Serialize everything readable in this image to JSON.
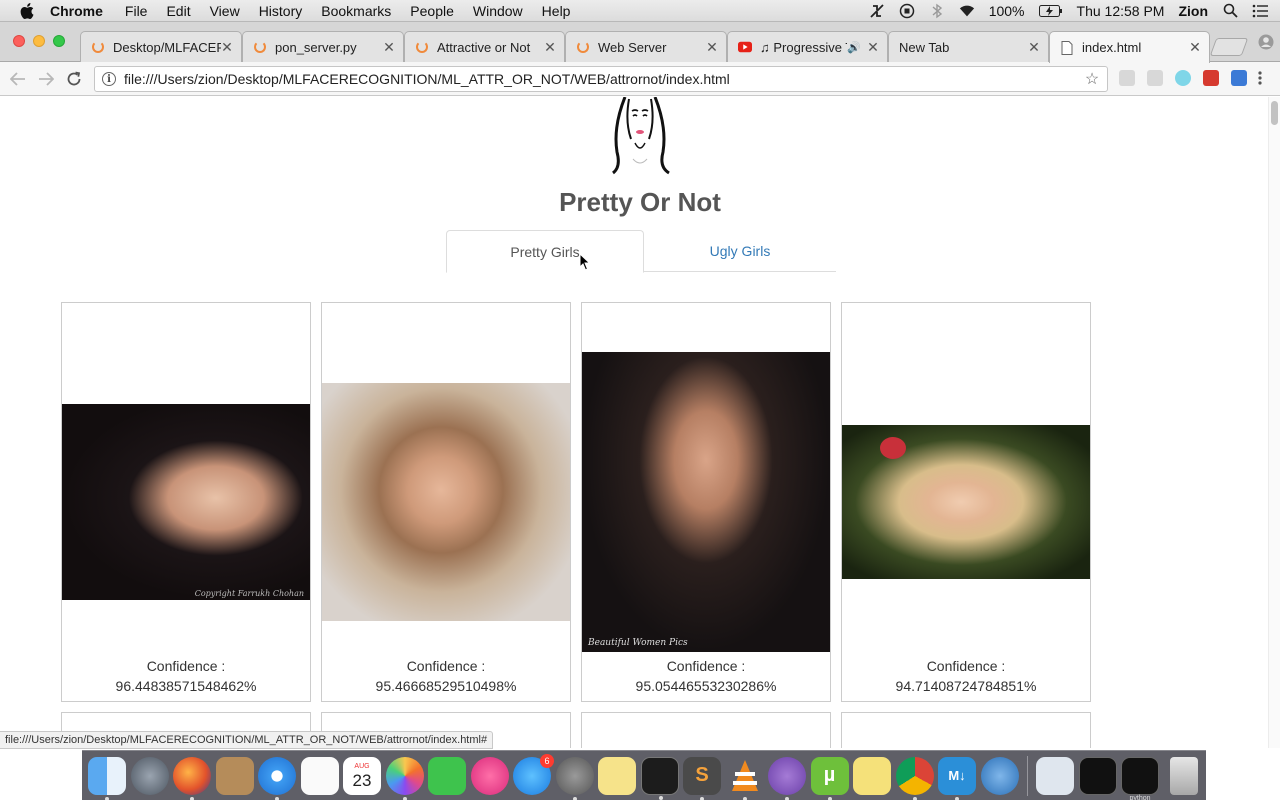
{
  "menubar": {
    "app_name": "Chrome",
    "items": [
      "File",
      "Edit",
      "View",
      "History",
      "Bookmarks",
      "People",
      "Window",
      "Help"
    ],
    "battery": "100%",
    "clock": "Thu 12:58 PM",
    "user": "Zion"
  },
  "tabs": [
    {
      "title": "Desktop/MLFACER",
      "favicon": "loading-spinner-icon"
    },
    {
      "title": "pon_server.py",
      "favicon": "loading-spinner-icon"
    },
    {
      "title": "Attractive or Not",
      "favicon": "loading-spinner-icon"
    },
    {
      "title": "Web Server",
      "favicon": "loading-spinner-icon"
    },
    {
      "title": "♫ Progressive T",
      "favicon": "youtube-icon"
    },
    {
      "title": "New Tab",
      "favicon": ""
    },
    {
      "title": "index.html",
      "favicon": "document-icon",
      "active": true
    }
  ],
  "address_bar": {
    "url": "file:///Users/zion/Desktop/MLFACERECOGNITION/ML_ATTR_OR_NOT/WEB/attrornot/index.html"
  },
  "page": {
    "title": "Pretty Or Not",
    "tabs": [
      {
        "label": "Pretty Girls",
        "active": true
      },
      {
        "label": "Ugly Girls",
        "active": false
      }
    ],
    "cards": [
      {
        "confidence_label": "Confidence :",
        "confidence_value": "96.44838571548462%",
        "photo_caption": "Copyright Farrukh Chohan"
      },
      {
        "confidence_label": "Confidence :",
        "confidence_value": "95.46668529510498%",
        "photo_caption": ""
      },
      {
        "confidence_label": "Confidence :",
        "confidence_value": "95.05446553230286%",
        "photo_caption": "Beautiful Women Pics"
      },
      {
        "confidence_label": "Confidence :",
        "confidence_value": "94.71408724784851%",
        "photo_caption": ""
      }
    ]
  },
  "status_bar": {
    "text": "file:///Users/zion/Desktop/MLFACERECOGNITION/ML_ATTR_OR_NOT/WEB/attrornot/index.html#"
  },
  "dock": {
    "calendar_month": "AUG",
    "calendar_day": "23",
    "app_store_badge": "6",
    "python_label": "python"
  },
  "colors": {
    "link": "#337ab7",
    "title": "#555555",
    "card_border": "#cccccc",
    "spinner": "#f08a3b"
  }
}
